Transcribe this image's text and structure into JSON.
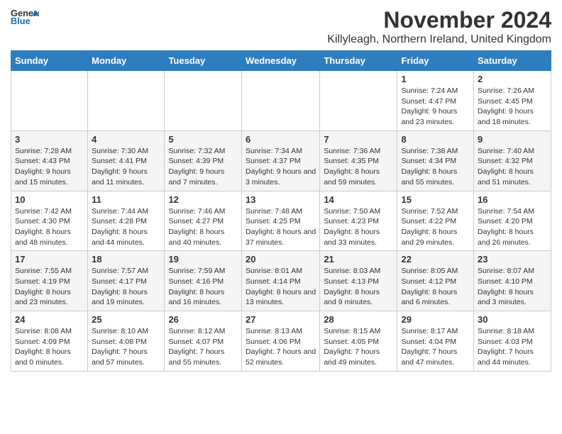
{
  "header": {
    "logo_general": "General",
    "logo_blue": "Blue",
    "month_title": "November 2024",
    "subtitle": "Killyleagh, Northern Ireland, United Kingdom"
  },
  "weekdays": [
    "Sunday",
    "Monday",
    "Tuesday",
    "Wednesday",
    "Thursday",
    "Friday",
    "Saturday"
  ],
  "weeks": [
    [
      {
        "day": "",
        "info": ""
      },
      {
        "day": "",
        "info": ""
      },
      {
        "day": "",
        "info": ""
      },
      {
        "day": "",
        "info": ""
      },
      {
        "day": "",
        "info": ""
      },
      {
        "day": "1",
        "info": "Sunrise: 7:24 AM\nSunset: 4:47 PM\nDaylight: 9 hours and 23 minutes."
      },
      {
        "day": "2",
        "info": "Sunrise: 7:26 AM\nSunset: 4:45 PM\nDaylight: 9 hours and 18 minutes."
      }
    ],
    [
      {
        "day": "3",
        "info": "Sunrise: 7:28 AM\nSunset: 4:43 PM\nDaylight: 9 hours and 15 minutes."
      },
      {
        "day": "4",
        "info": "Sunrise: 7:30 AM\nSunset: 4:41 PM\nDaylight: 9 hours and 11 minutes."
      },
      {
        "day": "5",
        "info": "Sunrise: 7:32 AM\nSunset: 4:39 PM\nDaylight: 9 hours and 7 minutes."
      },
      {
        "day": "6",
        "info": "Sunrise: 7:34 AM\nSunset: 4:37 PM\nDaylight: 9 hours and 3 minutes."
      },
      {
        "day": "7",
        "info": "Sunrise: 7:36 AM\nSunset: 4:35 PM\nDaylight: 8 hours and 59 minutes."
      },
      {
        "day": "8",
        "info": "Sunrise: 7:38 AM\nSunset: 4:34 PM\nDaylight: 8 hours and 55 minutes."
      },
      {
        "day": "9",
        "info": "Sunrise: 7:40 AM\nSunset: 4:32 PM\nDaylight: 8 hours and 51 minutes."
      }
    ],
    [
      {
        "day": "10",
        "info": "Sunrise: 7:42 AM\nSunset: 4:30 PM\nDaylight: 8 hours and 48 minutes."
      },
      {
        "day": "11",
        "info": "Sunrise: 7:44 AM\nSunset: 4:28 PM\nDaylight: 8 hours and 44 minutes."
      },
      {
        "day": "12",
        "info": "Sunrise: 7:46 AM\nSunset: 4:27 PM\nDaylight: 8 hours and 40 minutes."
      },
      {
        "day": "13",
        "info": "Sunrise: 7:48 AM\nSunset: 4:25 PM\nDaylight: 8 hours and 37 minutes."
      },
      {
        "day": "14",
        "info": "Sunrise: 7:50 AM\nSunset: 4:23 PM\nDaylight: 8 hours and 33 minutes."
      },
      {
        "day": "15",
        "info": "Sunrise: 7:52 AM\nSunset: 4:22 PM\nDaylight: 8 hours and 29 minutes."
      },
      {
        "day": "16",
        "info": "Sunrise: 7:54 AM\nSunset: 4:20 PM\nDaylight: 8 hours and 26 minutes."
      }
    ],
    [
      {
        "day": "17",
        "info": "Sunrise: 7:55 AM\nSunset: 4:19 PM\nDaylight: 8 hours and 23 minutes."
      },
      {
        "day": "18",
        "info": "Sunrise: 7:57 AM\nSunset: 4:17 PM\nDaylight: 8 hours and 19 minutes."
      },
      {
        "day": "19",
        "info": "Sunrise: 7:59 AM\nSunset: 4:16 PM\nDaylight: 8 hours and 16 minutes."
      },
      {
        "day": "20",
        "info": "Sunrise: 8:01 AM\nSunset: 4:14 PM\nDaylight: 8 hours and 13 minutes."
      },
      {
        "day": "21",
        "info": "Sunrise: 8:03 AM\nSunset: 4:13 PM\nDaylight: 8 hours and 9 minutes."
      },
      {
        "day": "22",
        "info": "Sunrise: 8:05 AM\nSunset: 4:12 PM\nDaylight: 8 hours and 6 minutes."
      },
      {
        "day": "23",
        "info": "Sunrise: 8:07 AM\nSunset: 4:10 PM\nDaylight: 8 hours and 3 minutes."
      }
    ],
    [
      {
        "day": "24",
        "info": "Sunrise: 8:08 AM\nSunset: 4:09 PM\nDaylight: 8 hours and 0 minutes."
      },
      {
        "day": "25",
        "info": "Sunrise: 8:10 AM\nSunset: 4:08 PM\nDaylight: 7 hours and 57 minutes."
      },
      {
        "day": "26",
        "info": "Sunrise: 8:12 AM\nSunset: 4:07 PM\nDaylight: 7 hours and 55 minutes."
      },
      {
        "day": "27",
        "info": "Sunrise: 8:13 AM\nSunset: 4:06 PM\nDaylight: 7 hours and 52 minutes."
      },
      {
        "day": "28",
        "info": "Sunrise: 8:15 AM\nSunset: 4:05 PM\nDaylight: 7 hours and 49 minutes."
      },
      {
        "day": "29",
        "info": "Sunrise: 8:17 AM\nSunset: 4:04 PM\nDaylight: 7 hours and 47 minutes."
      },
      {
        "day": "30",
        "info": "Sunrise: 8:18 AM\nSunset: 4:03 PM\nDaylight: 7 hours and 44 minutes."
      }
    ]
  ]
}
